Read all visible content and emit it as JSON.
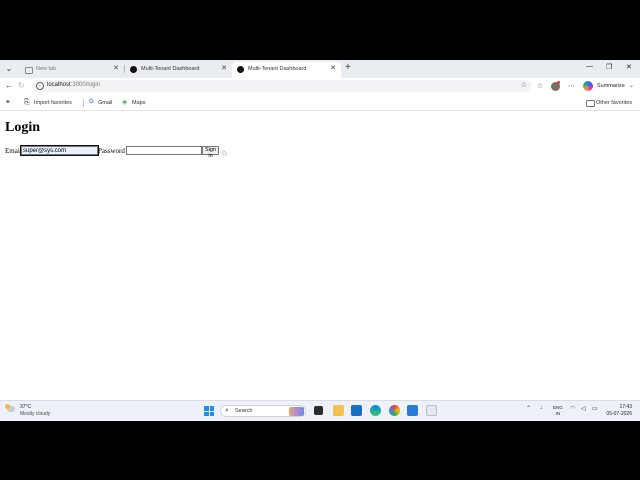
{
  "browser": {
    "tabs": [
      {
        "title": "New tab",
        "state": "inactive",
        "icon": "new-tab-icon"
      },
      {
        "title": "Multi-Tenant Dashboard",
        "state": "inactive",
        "icon": "site-icon"
      },
      {
        "title": "Multi-Tenant Dashboard",
        "state": "active",
        "icon": "site-icon"
      }
    ],
    "address": {
      "host": "localhost",
      "path": ":3000/login"
    },
    "summarize_label": "Summarize",
    "favorites": [
      {
        "label": "Import favorites",
        "icon": "import-icon"
      },
      {
        "label": "Gmail",
        "icon": "google-icon"
      },
      {
        "label": "Maps",
        "icon": "maps-icon"
      }
    ],
    "other_favorites": "Other favorites"
  },
  "page": {
    "title": "Login",
    "email": {
      "label": "Email",
      "value": "super@sys.com"
    },
    "password": {
      "label": "Password",
      "value": ""
    },
    "submit_label": "Sign in"
  },
  "taskbar": {
    "weather": {
      "temp": "37°C",
      "condition": "Mostly cloudy"
    },
    "search_label": "Search",
    "language": {
      "line1": "ENG",
      "line2": "IN"
    },
    "clock": {
      "time": "17:43",
      "date": "05-07-2026"
    }
  }
}
